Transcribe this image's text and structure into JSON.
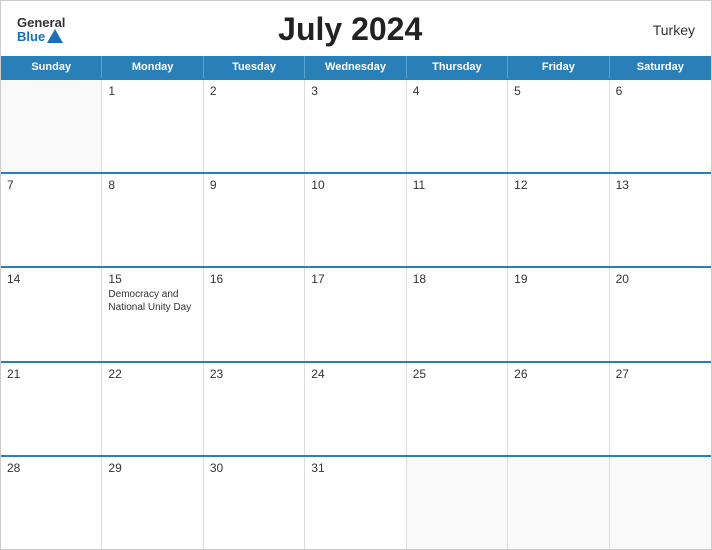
{
  "header": {
    "logo_general": "General",
    "logo_blue": "Blue",
    "title": "July 2024",
    "country": "Turkey"
  },
  "day_headers": [
    "Sunday",
    "Monday",
    "Tuesday",
    "Wednesday",
    "Thursday",
    "Friday",
    "Saturday"
  ],
  "weeks": [
    [
      {
        "day": "",
        "empty": true
      },
      {
        "day": "1",
        "event": ""
      },
      {
        "day": "2",
        "event": ""
      },
      {
        "day": "3",
        "event": ""
      },
      {
        "day": "4",
        "event": ""
      },
      {
        "day": "5",
        "event": ""
      },
      {
        "day": "6",
        "event": ""
      }
    ],
    [
      {
        "day": "7",
        "event": ""
      },
      {
        "day": "8",
        "event": ""
      },
      {
        "day": "9",
        "event": ""
      },
      {
        "day": "10",
        "event": ""
      },
      {
        "day": "11",
        "event": ""
      },
      {
        "day": "12",
        "event": ""
      },
      {
        "day": "13",
        "event": ""
      }
    ],
    [
      {
        "day": "14",
        "event": ""
      },
      {
        "day": "15",
        "event": "Democracy and National Unity Day"
      },
      {
        "day": "16",
        "event": ""
      },
      {
        "day": "17",
        "event": ""
      },
      {
        "day": "18",
        "event": ""
      },
      {
        "day": "19",
        "event": ""
      },
      {
        "day": "20",
        "event": ""
      }
    ],
    [
      {
        "day": "21",
        "event": ""
      },
      {
        "day": "22",
        "event": ""
      },
      {
        "day": "23",
        "event": ""
      },
      {
        "day": "24",
        "event": ""
      },
      {
        "day": "25",
        "event": ""
      },
      {
        "day": "26",
        "event": ""
      },
      {
        "day": "27",
        "event": ""
      }
    ],
    [
      {
        "day": "28",
        "event": ""
      },
      {
        "day": "29",
        "event": ""
      },
      {
        "day": "30",
        "event": ""
      },
      {
        "day": "31",
        "event": ""
      },
      {
        "day": "",
        "empty": true
      },
      {
        "day": "",
        "empty": true
      },
      {
        "day": "",
        "empty": true
      }
    ]
  ]
}
